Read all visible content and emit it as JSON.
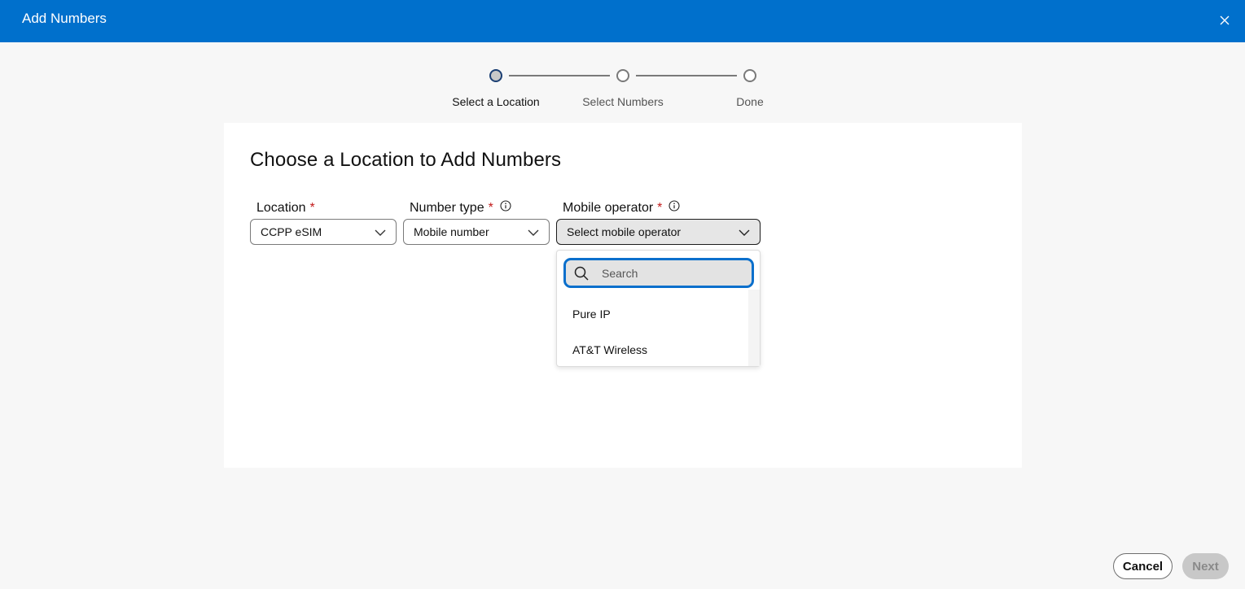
{
  "header": {
    "title": "Add Numbers",
    "close_icon": "close-icon"
  },
  "stepper": {
    "steps": [
      {
        "label": "Select a Location",
        "state": "active"
      },
      {
        "label": "Select Numbers",
        "state": "inactive"
      },
      {
        "label": "Done",
        "state": "inactive"
      }
    ]
  },
  "main": {
    "title": "Choose a Location to Add Numbers",
    "fields": {
      "location": {
        "label": "Location",
        "required_mark": "*",
        "value": "CCPP eSIM"
      },
      "number_type": {
        "label": "Number type",
        "required_mark": "*",
        "value": "Mobile number",
        "info_icon": "info-icon"
      },
      "mobile_operator": {
        "label": "Mobile operator",
        "required_mark": "*",
        "placeholder": "Select mobile operator",
        "info_icon": "info-icon"
      }
    },
    "dropdown": {
      "search_placeholder": "Search",
      "search_value": "",
      "options": [
        "Pure IP",
        "AT&T Wireless"
      ]
    }
  },
  "footer": {
    "cancel_label": "Cancel",
    "next_label": "Next"
  },
  "colors": {
    "brand": "#0070cc",
    "required": "#c21a1a",
    "focus": "#0a6fcc",
    "disabled": "#c8c8c8"
  }
}
